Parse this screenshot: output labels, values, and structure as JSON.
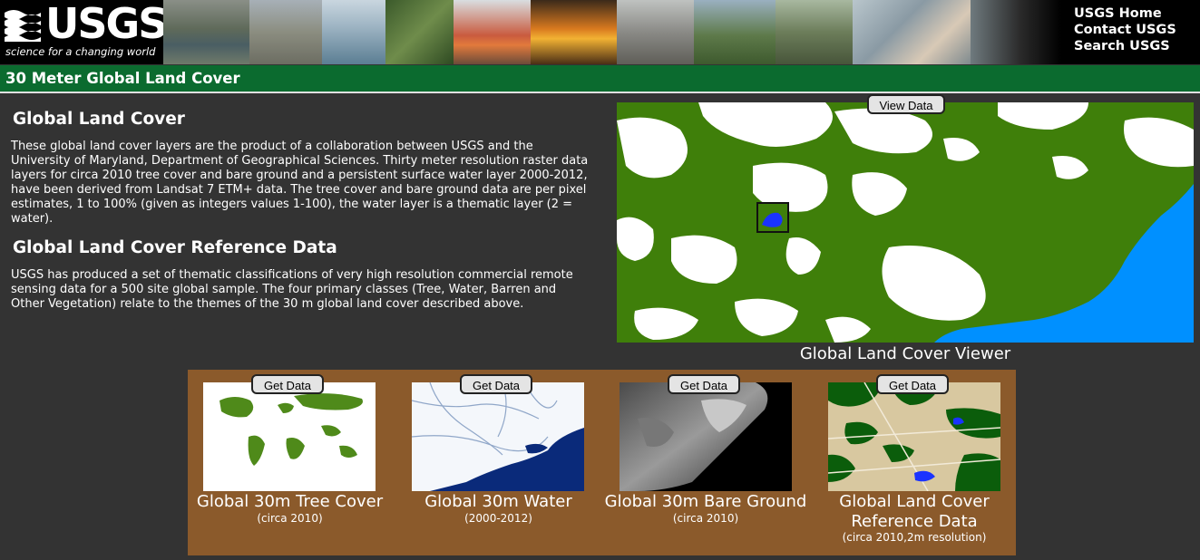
{
  "header": {
    "logo_word": "USGS",
    "logo_tagline": "science for a changing world",
    "links": [
      "USGS Home",
      "Contact USGS",
      "Search USGS"
    ]
  },
  "titlebar": {
    "title": "30 Meter Global Land Cover"
  },
  "section1": {
    "heading": "Global Land Cover",
    "body": "These global land cover layers are the product of a collaboration between USGS and the University of Maryland, Department of Geographical Sciences. Thirty meter resolution raster data layers for circa 2010 tree cover and bare ground and a persistent surface water layer 2000-2012, have been derived from Landsat 7 ETM+ data. The tree cover and bare ground data are per pixel estimates, 1 to 100% (given as integers values 1-100), the water layer is a thematic layer (2 = water)."
  },
  "section2": {
    "heading": "Global Land Cover Reference Data",
    "body": "USGS has produced a set of thematic classifications of very high resolution commercial remote sensing data for a 500 site global sample. The four primary classes (Tree, Water, Barren and Other Vegetation) relate to the themes of the 30 m global land cover described above."
  },
  "viewer": {
    "button": "View Data",
    "label": "Global Land Cover Viewer"
  },
  "cards": [
    {
      "button": "Get Data",
      "title": "Global 30m Tree Cover",
      "subtitle": "(circa 2010)"
    },
    {
      "button": "Get Data",
      "title": "Global 30m Water",
      "subtitle": "(2000-2012)"
    },
    {
      "button": "Get Data",
      "title": "Global 30m Bare Ground",
      "subtitle": "(circa 2010)"
    },
    {
      "button": "Get Data",
      "title": "Global Land Cover Reference Data",
      "subtitle": "(circa 2010,2m resolution)"
    }
  ],
  "colors": {
    "title_bar": "#0b6b2f",
    "background": "#333333",
    "panel": "#8b5a2b",
    "vegetation": "#3f7f0a",
    "water": "#0090ff"
  }
}
